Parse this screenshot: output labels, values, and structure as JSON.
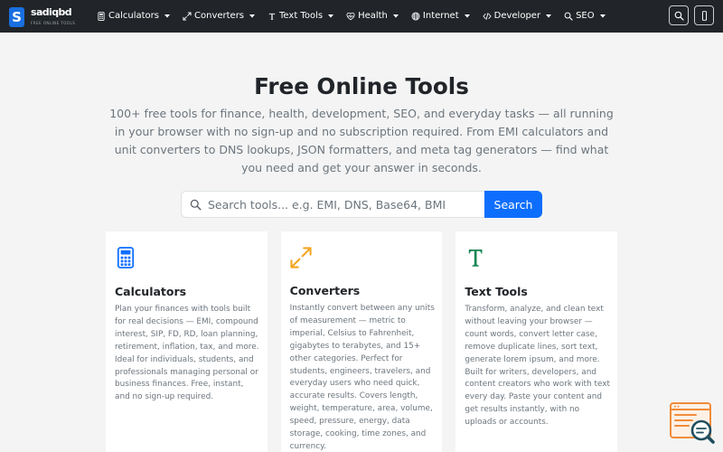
{
  "brand": {
    "logo_letter": "S",
    "name": "sadiqbd",
    "tagline": "FREE ONLINE TOOLS"
  },
  "nav": {
    "items": [
      {
        "label": "Calculators",
        "icon": "calculator-icon"
      },
      {
        "label": "Converters",
        "icon": "arrows-expand-icon"
      },
      {
        "label": "Text Tools",
        "icon": "text-t-icon"
      },
      {
        "label": "Health",
        "icon": "heart-pulse-icon"
      },
      {
        "label": "Internet",
        "icon": "globe-icon"
      },
      {
        "label": "Developer",
        "icon": "code-icon"
      },
      {
        "label": "SEO",
        "icon": "search-icon"
      }
    ],
    "actions": [
      {
        "icon": "search-icon"
      },
      {
        "icon": "mobile-icon"
      }
    ]
  },
  "hero": {
    "title": "Free Online Tools",
    "description_lines": [
      "100+ free tools for finance, health, development, SEO, and everyday tasks — all running",
      "in your browser with no sign-up and no subscription required. From EMI calculators and",
      "unit converters to DNS lookups, JSON formatters, and meta tag generators — find what",
      "you need and get your answer in seconds."
    ]
  },
  "search": {
    "icon": "search-icon",
    "placeholder": "Search tools... e.g. EMI, DNS, Base64, BMI",
    "value": "",
    "button_label": "Search"
  },
  "cards": [
    {
      "title": "Calculators",
      "icon": "calculator-icon",
      "icon_color": "#0d6efd",
      "description_lines": [
        "Plan your finances with tools built",
        "for real decisions — EMI, compound",
        "interest, SIP, FD, RD, loan planning,",
        "retirement, inflation, tax, and more.",
        "Ideal for individuals, students, and",
        "professionals managing personal or",
        "business finances. Free, instant,",
        "and no sign-up required."
      ]
    },
    {
      "title": "Converters",
      "icon": "arrows-expand-icon",
      "icon_color": "#f2a51f",
      "description_lines": [
        "Instantly convert between any units",
        "of measurement — metric to",
        "imperial, Celsius to Fahrenheit,",
        "gigabytes to terabytes, and 15+",
        "other categories. Perfect for",
        "students, engineers, travelers, and",
        "everyday users who need quick,",
        "accurate results. Covers length,",
        "weight, temperature, area, volume,",
        "speed, pressure, energy, data",
        "storage, cooking, time zones, and",
        "currency."
      ]
    },
    {
      "title": "Text Tools",
      "icon": "text-t-icon",
      "icon_color": "#198754",
      "description_lines": [
        "Transform, analyze, and clean text",
        "without leaving your browser —",
        "count words, convert letter case,",
        "remove duplicate lines, sort text,",
        "generate lorem ipsum, and more.",
        "Built for writers, developers, and",
        "content creators who work with text",
        "every day. Paste your content and",
        "get results instantly, with no",
        "uploads or accounts."
      ]
    }
  ],
  "floating_widget": {
    "icon": "search-document-icon"
  },
  "colors": {
    "navbar": "#212529",
    "background": "#f4f4f4",
    "accent": "#0d6efd",
    "logo": "#1a6fe0",
    "widget_orange": "#f08c3a",
    "widget_teal": "#1f4e5f"
  }
}
